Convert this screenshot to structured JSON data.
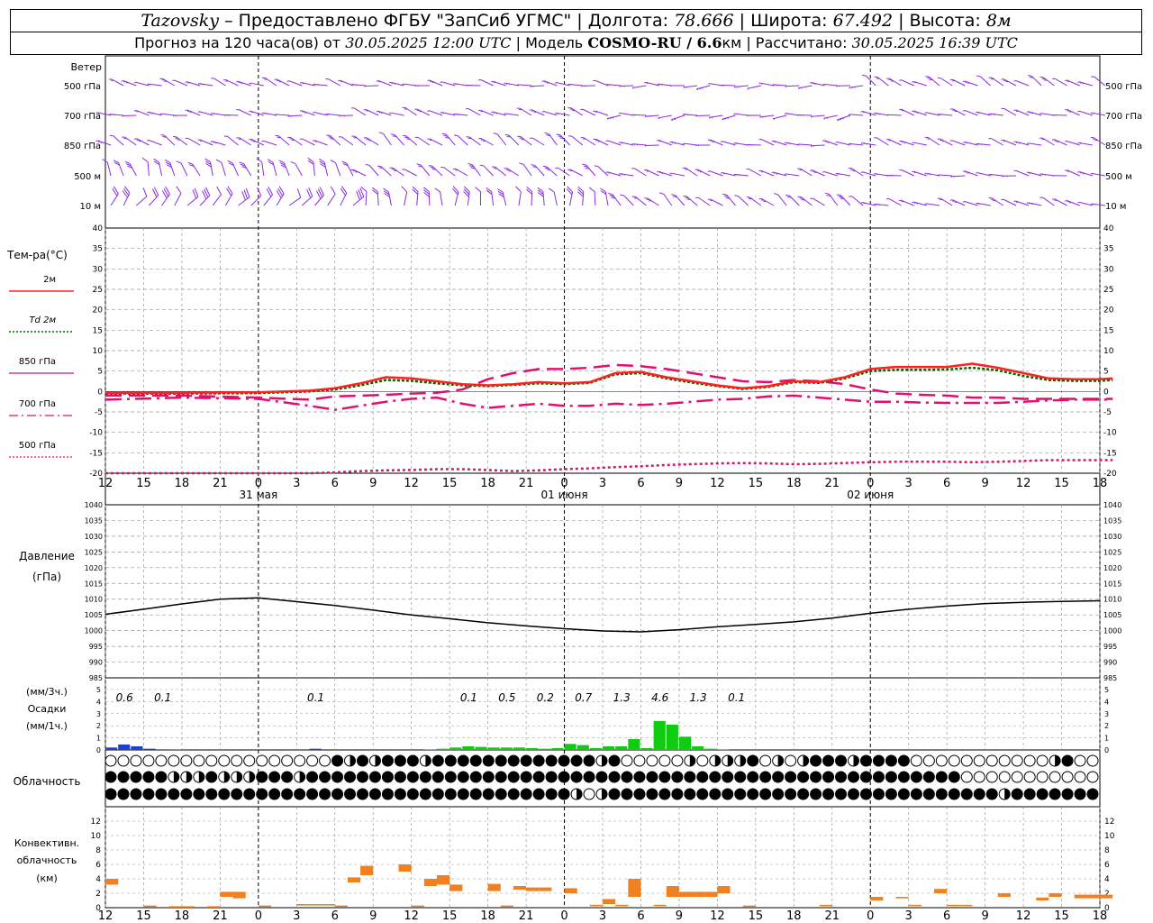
{
  "header": {
    "station": "Tazovsky",
    "provider": "– Предоставлено ФГБУ \"ЗапСиб УГМС\"",
    "lon_label": "| Долгота:",
    "lon": "78.666",
    "lat_label": "| Широта:",
    "lat": "67.492",
    "alt_label": "| Высота:",
    "alt": "8м",
    "forecast_label": "Прогноз на 120 часа(ов) от",
    "forecast_start": "30.05.2025 12:00 UTC",
    "model_label": "| Модель",
    "model": "COSMO-RU / 6.6",
    "model_unit": "км",
    "calc_label": "| Рассчитано:",
    "calc_time": "30.05.2025 16:39 UTC"
  },
  "colors": {
    "t2m": "#ff2020",
    "td2m": "#006400",
    "t850": "#e0106f",
    "t700": "#e0106f",
    "t500": "#e0106f",
    "wind": "#8a2be2",
    "precip_snow": "#1f3fd0",
    "precip_rain": "#10cc10",
    "convective": "#f08020",
    "pressure": "#000000",
    "grid": "#999999"
  },
  "wind": {
    "title": "Ветер",
    "levels": [
      "500 гПа",
      "700 гПа",
      "850 гПа",
      "500 м",
      "10  м"
    ]
  },
  "temperature": {
    "title": "Тем-ра(°С)",
    "legend": [
      {
        "label": "2м",
        "style": "solid-red"
      },
      {
        "label": "Td  2м",
        "style": "dotted-green"
      },
      {
        "label": "850 гПа",
        "style": "long-dash"
      },
      {
        "label": "700 гПа",
        "style": "dash-dot"
      },
      {
        "label": "500 гПа",
        "style": "short-dot"
      }
    ],
    "ylim": [
      -20,
      40
    ],
    "yticks": [
      "40",
      "35",
      "30",
      "25",
      "20",
      "15",
      "10",
      "5",
      "0",
      "-5",
      "-10",
      "-15",
      "-20"
    ],
    "xticks": [
      "12",
      "15",
      "18",
      "21",
      "0",
      "3",
      "6",
      "9",
      "12",
      "15",
      "18",
      "21",
      "0",
      "3",
      "6",
      "9",
      "12",
      "15",
      "18",
      "21",
      "0",
      "3",
      "6",
      "9",
      "12",
      "15",
      "18"
    ],
    "day_labels": [
      {
        "hour": 12,
        "label": "31 мая"
      },
      {
        "hour": 36,
        "label": "01 июня"
      },
      {
        "hour": 60,
        "label": "02 июня"
      }
    ]
  },
  "pressure": {
    "title": "Давление",
    "unit": "(гПа)",
    "ylim": [
      985,
      1040
    ],
    "yticks": [
      "1040",
      "1035",
      "1030",
      "1025",
      "1020",
      "1015",
      "1010",
      "1005",
      "1000",
      "995",
      "990",
      "985"
    ]
  },
  "precip": {
    "title_top": "(мм/3ч.)",
    "title_mid": "Осадки",
    "title_bot": "(мм/1ч.)",
    "yticks": [
      "5",
      "4",
      "3",
      "2",
      "1",
      "0"
    ],
    "totals": [
      {
        "hour": 1.5,
        "label": "0.6"
      },
      {
        "hour": 4.5,
        "label": "0.1"
      },
      {
        "hour": 16.5,
        "label": "0.1"
      },
      {
        "hour": 28.5,
        "label": "0.1"
      },
      {
        "hour": 31.5,
        "label": "0.5"
      },
      {
        "hour": 34.5,
        "label": "0.2"
      },
      {
        "hour": 37.5,
        "label": "0.7"
      },
      {
        "hour": 40.5,
        "label": "1.3"
      },
      {
        "hour": 43.5,
        "label": "4.6"
      },
      {
        "hour": 46.5,
        "label": "1.3"
      },
      {
        "hour": 49.5,
        "label": "0.1"
      }
    ]
  },
  "cloud": {
    "title": "Облачность"
  },
  "convective": {
    "title1": "Конвективн.",
    "title2": "облачность",
    "title3": "(км)",
    "yticks": [
      "12",
      "10",
      "8",
      "6",
      "4",
      "2",
      "0"
    ]
  },
  "chart_data": [
    {
      "type": "line",
      "title": "Тем-ра(°С)",
      "x_hours_from_start": [
        0,
        6,
        12,
        16,
        18,
        20,
        22,
        24,
        26,
        28,
        30,
        32,
        34,
        36,
        38,
        40,
        42,
        44,
        46,
        48,
        50,
        52,
        54,
        56,
        58,
        60,
        62,
        64,
        66,
        68,
        70,
        72,
        74,
        76,
        78,
        79
      ],
      "ylim": [
        -20,
        40
      ],
      "series": [
        {
          "name": "2м",
          "values": [
            -0.3,
            -0.3,
            -0.2,
            0.2,
            0.8,
            2.0,
            3.5,
            3.2,
            2.5,
            1.8,
            1.5,
            1.8,
            2.3,
            2.0,
            2.3,
            4.5,
            4.8,
            3.5,
            2.5,
            1.5,
            0.8,
            1.3,
            2.5,
            2.3,
            3.5,
            5.5,
            6.0,
            6.0,
            6.0,
            6.8,
            5.8,
            4.5,
            3.2,
            3.0,
            3.0,
            3.2
          ]
        },
        {
          "name": "Td  2м",
          "values": [
            -0.5,
            -0.5,
            -0.4,
            0.0,
            0.5,
            1.5,
            2.8,
            2.6,
            2.0,
            1.5,
            1.3,
            1.6,
            2.0,
            1.8,
            2.1,
            4.2,
            4.5,
            3.2,
            2.2,
            1.3,
            0.6,
            1.1,
            2.3,
            2.1,
            3.2,
            5.0,
            5.3,
            5.3,
            5.4,
            5.8,
            5.2,
            3.8,
            2.8,
            2.6,
            2.6,
            2.8
          ]
        },
        {
          "name": "850 гПа",
          "values": [
            -1.0,
            -1.0,
            -1.5,
            -2.0,
            -1.2,
            -1.0,
            -0.8,
            -0.5,
            -0.3,
            0.5,
            3.0,
            4.5,
            5.5,
            5.5,
            5.8,
            6.5,
            6.2,
            5.5,
            4.5,
            3.5,
            2.5,
            2.3,
            2.8,
            2.5,
            1.8,
            0.5,
            -0.5,
            -0.8,
            -1.0,
            -1.5,
            -1.5,
            -1.8,
            -1.8,
            -1.8,
            -1.8,
            -1.8
          ]
        },
        {
          "name": "700 гПа",
          "values": [
            -2.0,
            -1.5,
            -1.8,
            -3.5,
            -4.5,
            -3.5,
            -2.5,
            -1.8,
            -1.5,
            -3.0,
            -4.0,
            -3.5,
            -3.0,
            -3.5,
            -3.5,
            -3.0,
            -3.3,
            -3.0,
            -2.5,
            -2.0,
            -1.8,
            -1.2,
            -1.0,
            -1.5,
            -2.0,
            -2.5,
            -2.5,
            -2.7,
            -2.8,
            -2.8,
            -2.8,
            -2.5,
            -2.2,
            -2.0,
            -2.0,
            -2.0
          ]
        },
        {
          "name": "500 гПа",
          "values": [
            -22,
            -21,
            -20.5,
            -20,
            -19.8,
            -19.5,
            -19.3,
            -19.2,
            -19.0,
            -19.0,
            -19.2,
            -19.5,
            -19.3,
            -19.0,
            -18.8,
            -18.5,
            -18.3,
            -18.0,
            -17.8,
            -17.6,
            -17.5,
            -17.6,
            -17.8,
            -17.7,
            -17.5,
            -17.3,
            -17.2,
            -17.2,
            -17.2,
            -17.3,
            -17.2,
            -17.0,
            -16.8,
            -16.8,
            -16.8,
            -16.8
          ]
        }
      ]
    },
    {
      "type": "line",
      "title": "Давление",
      "x_hours_from_start": [
        0,
        3,
        6,
        9,
        12,
        15,
        18,
        21,
        24,
        27,
        30,
        33,
        36,
        39,
        42,
        45,
        48,
        51,
        54,
        57,
        60,
        63,
        66,
        69,
        72,
        75,
        78
      ],
      "ylim": [
        985,
        1040
      ],
      "series": [
        {
          "name": "Давление",
          "values": [
            1005.2,
            1006.8,
            1008.5,
            1010.0,
            1010.4,
            1009.2,
            1008.0,
            1006.5,
            1005.0,
            1003.8,
            1002.5,
            1001.5,
            1000.6,
            999.9,
            999.6,
            1000.3,
            1001.2,
            1002.0,
            1002.8,
            1004.0,
            1005.5,
            1006.8,
            1007.8,
            1008.6,
            1009.0,
            1009.3,
            1009.5
          ]
        }
      ]
    },
    {
      "type": "bar",
      "title": "Осадки",
      "x_hours_from_start": [
        0,
        1,
        2,
        3,
        4,
        5,
        16,
        25,
        26,
        27,
        28,
        29,
        30,
        31,
        32,
        33,
        34,
        35,
        36,
        37,
        38,
        39,
        40,
        41,
        42,
        43,
        44,
        45,
        46,
        47,
        48
      ],
      "ylim": [
        0,
        5
      ],
      "series": [
        {
          "name": "snow",
          "values": [
            0.2,
            0.45,
            0.3,
            0.1,
            0.05,
            0.02,
            0.1,
            0,
            0,
            0,
            0,
            0,
            0,
            0,
            0,
            0,
            0,
            0,
            0,
            0,
            0,
            0,
            0,
            0,
            0,
            0,
            0,
            0,
            0,
            0,
            0
          ]
        },
        {
          "name": "rain",
          "values": [
            0,
            0,
            0,
            0,
            0,
            0,
            0,
            0.05,
            0.1,
            0.2,
            0.3,
            0.25,
            0.2,
            0.2,
            0.2,
            0.15,
            0.1,
            0.15,
            0.5,
            0.4,
            0.15,
            0.3,
            0.3,
            0.9,
            0.15,
            2.4,
            2.1,
            1.1,
            0.3,
            0.1,
            0.05
          ]
        }
      ]
    },
    {
      "type": "bar",
      "title": "Конвективн. облачность",
      "x_hours_from_start": [
        0,
        3,
        5,
        6,
        8,
        9,
        10,
        12,
        15,
        16,
        17,
        18,
        19,
        20,
        23,
        24,
        25,
        26,
        27,
        30,
        31,
        32,
        33,
        34,
        36,
        38,
        39,
        40,
        41,
        43,
        44,
        45,
        46,
        47,
        48,
        50,
        56,
        60,
        62,
        63,
        65,
        66,
        67,
        70,
        73,
        74,
        76,
        77,
        78
      ],
      "ylim": [
        0,
        13
      ],
      "series": [
        {
          "name": "base_km",
          "values": [
            3.2,
            0.2,
            0.1,
            0.1,
            0.1,
            1.5,
            1.3,
            0.2,
            0.3,
            0.3,
            0.3,
            0.2,
            3.5,
            4.5,
            5.0,
            0.2,
            3.0,
            3.2,
            2.3,
            2.3,
            0.2,
            2.5,
            2.3,
            2.3,
            2.0,
            0.2,
            0.5,
            0.2,
            1.5,
            0.3,
            1.5,
            1.5,
            1.5,
            1.5,
            2.0,
            0.2,
            0.2,
            1.0,
            1.3,
            0.3,
            2.0,
            0.3,
            0.3,
            1.5,
            1.0,
            1.5,
            1.3,
            1.3,
            1.3
          ]
        },
        {
          "name": "top_km",
          "values": [
            4.0,
            0.3,
            0.2,
            0.2,
            0.2,
            2.2,
            2.2,
            0.3,
            0.5,
            0.5,
            0.5,
            0.3,
            4.2,
            5.8,
            6.0,
            0.3,
            4.0,
            4.5,
            3.2,
            3.3,
            0.3,
            3.0,
            2.8,
            2.8,
            2.7,
            0.4,
            1.2,
            0.4,
            4.0,
            0.4,
            3.0,
            2.2,
            2.2,
            2.2,
            3.0,
            0.3,
            0.4,
            1.5,
            1.5,
            0.4,
            2.6,
            0.4,
            0.4,
            2.0,
            1.4,
            2.0,
            1.8,
            1.8,
            1.8
          ]
        }
      ]
    }
  ]
}
